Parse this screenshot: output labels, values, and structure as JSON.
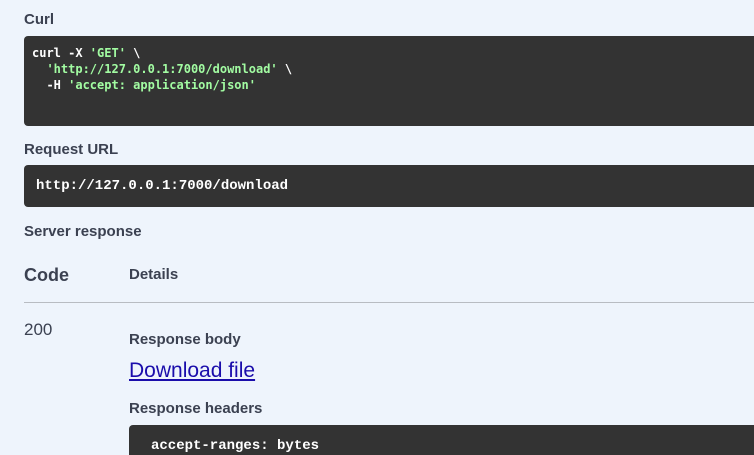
{
  "curl": {
    "label": "Curl",
    "lines": [
      [
        {
          "t": "curl -X ",
          "c": "w"
        },
        {
          "t": "'GET'",
          "c": "g"
        },
        {
          "t": " \\",
          "c": "w"
        }
      ],
      [
        {
          "t": "  ",
          "c": "w"
        },
        {
          "t": "'http://127.0.0.1:7000/download'",
          "c": "g"
        },
        {
          "t": " \\",
          "c": "w"
        }
      ],
      [
        {
          "t": "  -H ",
          "c": "w"
        },
        {
          "t": "'accept: application/json'",
          "c": "g"
        }
      ]
    ]
  },
  "request_url": {
    "label": "Request URL",
    "value": "http://127.0.0.1:7000/download"
  },
  "server_response": {
    "label": "Server response",
    "col_code": "Code",
    "col_details": "Details",
    "code": "200",
    "body_label": "Response body",
    "download_link": "Download file",
    "headers_label": "Response headers",
    "headers_first_line": "accept-ranges: bytes"
  }
}
